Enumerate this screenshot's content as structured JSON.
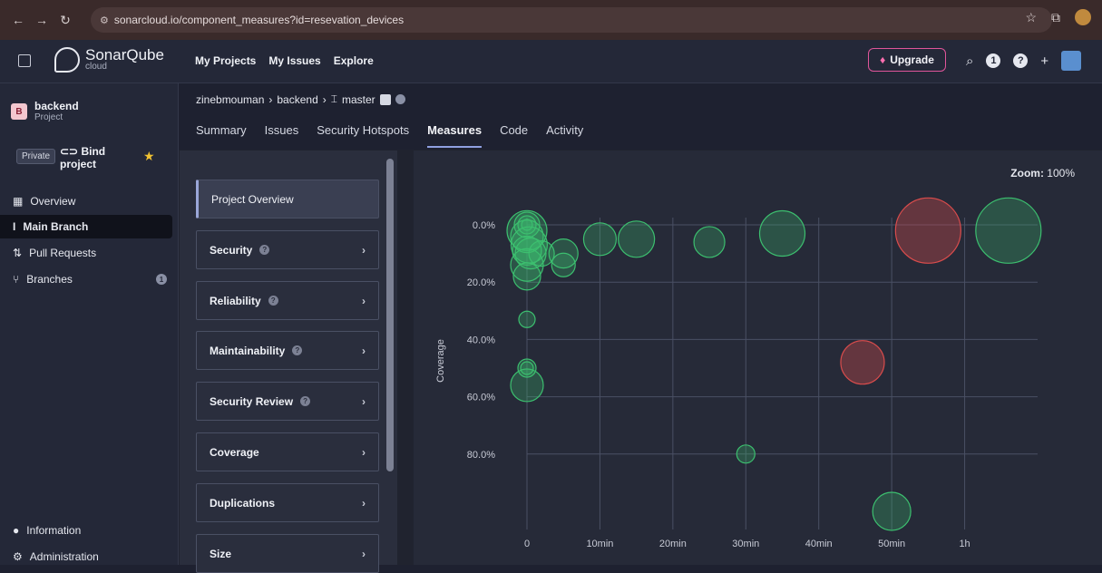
{
  "browser": {
    "url": "sonarcloud.io/component_measures?id=resevation_devices"
  },
  "header": {
    "logo_text": "SonarQube",
    "logo_sub": "cloud",
    "nav": [
      "My Projects",
      "My Issues",
      "Explore"
    ],
    "upgrade_label": "Upgrade",
    "notification_count": "1"
  },
  "sidebar": {
    "project_badge": "B",
    "project_name": "backend",
    "project_type": "Project",
    "private_label": "Private",
    "bind_label": "Bind project",
    "items": [
      {
        "label": "Overview",
        "icon": "grid-icon"
      },
      {
        "label": "Main Branch",
        "icon": "branch-icon"
      },
      {
        "label": "Pull Requests",
        "icon": "pull-request-icon"
      },
      {
        "label": "Branches",
        "icon": "branches-icon",
        "count": "1"
      }
    ],
    "bottom_items": [
      "Information",
      "Administration"
    ]
  },
  "breadcrumb": {
    "org": "zinebmouman",
    "project": "backend",
    "branch": "master"
  },
  "tabs": [
    "Summary",
    "Issues",
    "Security Hotspots",
    "Measures",
    "Code",
    "Activity"
  ],
  "active_tab": "Measures",
  "facets": [
    "Project Overview",
    "Security",
    "Reliability",
    "Maintainability",
    "Security Review",
    "Coverage",
    "Duplications",
    "Size"
  ],
  "zoom": {
    "label": "Zoom:",
    "value": "100%"
  },
  "chart_data": {
    "type": "scatter",
    "title": "",
    "xlabel": "",
    "ylabel": "Coverage",
    "x_ticks": [
      "0",
      "10min",
      "20min",
      "30min",
      "40min",
      "50min",
      "1h"
    ],
    "y_ticks": [
      "0.0%",
      "20.0%",
      "40.0%",
      "60.0%",
      "80.0%"
    ],
    "x_unit": "minutes",
    "xlim": [
      0,
      70
    ],
    "ylim": [
      0,
      100
    ],
    "y_inverted": true,
    "colors": {
      "green": "#3cbf6f",
      "red": "#d94c4c"
    },
    "points": [
      {
        "x": 0,
        "y": 0,
        "r": 14,
        "color": "green"
      },
      {
        "x": 0,
        "y": 0,
        "r": 10,
        "color": "green"
      },
      {
        "x": 0,
        "y": 0,
        "r": 6,
        "color": "green"
      },
      {
        "x": 0,
        "y": 2,
        "r": 22,
        "color": "green"
      },
      {
        "x": 0,
        "y": 4,
        "r": 18,
        "color": "green"
      },
      {
        "x": 0.3,
        "y": 7,
        "r": 20,
        "color": "green"
      },
      {
        "x": 0,
        "y": 9,
        "r": 16,
        "color": "green"
      },
      {
        "x": 0.5,
        "y": 10,
        "r": 17,
        "color": "green"
      },
      {
        "x": 2,
        "y": 10,
        "r": 14,
        "color": "green"
      },
      {
        "x": 5,
        "y": 10,
        "r": 16,
        "color": "green"
      },
      {
        "x": 5,
        "y": 14,
        "r": 13,
        "color": "green"
      },
      {
        "x": 0,
        "y": 14,
        "r": 18,
        "color": "green"
      },
      {
        "x": 0,
        "y": 18,
        "r": 15,
        "color": "green"
      },
      {
        "x": 10,
        "y": 5,
        "r": 18,
        "color": "green"
      },
      {
        "x": 15,
        "y": 5,
        "r": 20,
        "color": "green"
      },
      {
        "x": 25,
        "y": 6,
        "r": 17,
        "color": "green"
      },
      {
        "x": 35,
        "y": 3,
        "r": 25,
        "color": "green"
      },
      {
        "x": 55,
        "y": 2,
        "r": 36,
        "color": "red"
      },
      {
        "x": 66,
        "y": 2,
        "r": 36,
        "color": "green"
      },
      {
        "x": 0,
        "y": 33,
        "r": 9,
        "color": "green"
      },
      {
        "x": 0,
        "y": 50,
        "r": 10,
        "color": "green"
      },
      {
        "x": 0,
        "y": 50,
        "r": 7,
        "color": "green"
      },
      {
        "x": 0,
        "y": 56,
        "r": 18,
        "color": "green"
      },
      {
        "x": 46,
        "y": 48,
        "r": 24,
        "color": "red"
      },
      {
        "x": 30,
        "y": 80,
        "r": 10,
        "color": "green"
      },
      {
        "x": 50,
        "y": 100,
        "r": 21,
        "color": "green"
      }
    ]
  }
}
